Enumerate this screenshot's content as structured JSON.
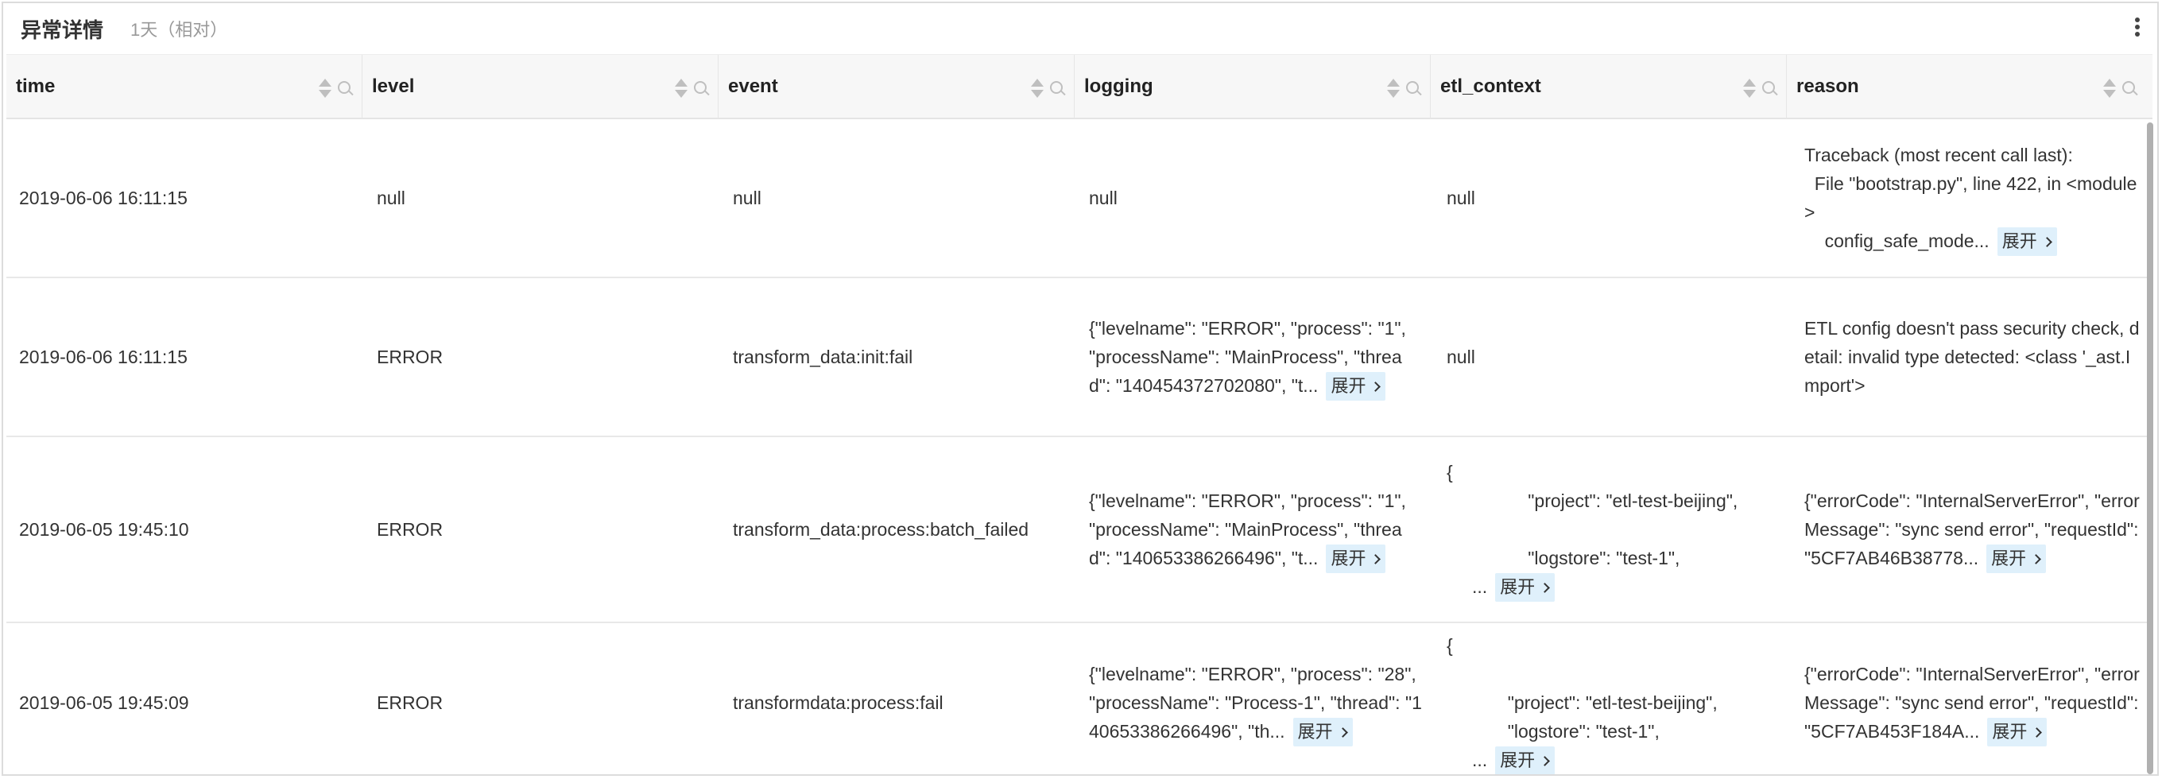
{
  "panel": {
    "title": "异常详情",
    "time_range": "1天（相对）"
  },
  "columns": [
    {
      "key": "time",
      "label": "time"
    },
    {
      "key": "level",
      "label": "level"
    },
    {
      "key": "event",
      "label": "event"
    },
    {
      "key": "logging",
      "label": "logging"
    },
    {
      "key": "etl_context",
      "label": "etl_context"
    },
    {
      "key": "reason",
      "label": "reason"
    }
  ],
  "expand_label": "展开",
  "rows": [
    {
      "time": "2019-06-06 16:11:15",
      "level": "null",
      "event": "null",
      "logging": "null",
      "etl_context": "null",
      "reason": "Traceback (most recent call last):\n  File \"bootstrap.py\", line 422, in <module>\n    config_safe_mode..."
    },
    {
      "time": "2019-06-06 16:11:15",
      "level": "ERROR",
      "event": "transform_data:init:fail",
      "logging": "{\"levelname\": \"ERROR\", \"process\": \"1\", \"processName\": \"MainProcess\", \"thread\": \"140454372702080\", \"t...",
      "etl_context": "null",
      "reason": "ETL config doesn't pass security check, detail: invalid type detected: <class '_ast.Import'>"
    },
    {
      "time": "2019-06-05 19:45:10",
      "level": "ERROR",
      "event": "transform_data:process:batch_failed",
      "logging": "{\"levelname\": \"ERROR\", \"process\": \"1\", \"processName\": \"MainProcess\", \"thread\": \"140653386266496\", \"t...",
      "etl_context": "{\n                \"project\": \"etl-test-beijing\",\n\n                \"logstore\": \"test-1\",\n     ...",
      "reason": "{\"errorCode\": \"InternalServerError\", \"errorMessage\": \"sync send error\", \"requestId\": \"5CF7AB46B38778..."
    },
    {
      "time": "2019-06-05 19:45:09",
      "level": "ERROR",
      "event": "transformdata:process:fail",
      "logging": "{\"levelname\": \"ERROR\", \"process\": \"28\", \"processName\": \"Process-1\", \"thread\": \"140653386266496\", \"th...",
      "etl_context": "{\n\n            \"project\": \"etl-test-beijing\",\n            \"logstore\": \"test-1\",\n     ...",
      "reason": "{\"errorCode\": \"InternalServerError\", \"errorMessage\": \"sync send error\", \"requestId\": \"5CF7AB453F184A..."
    }
  ]
}
